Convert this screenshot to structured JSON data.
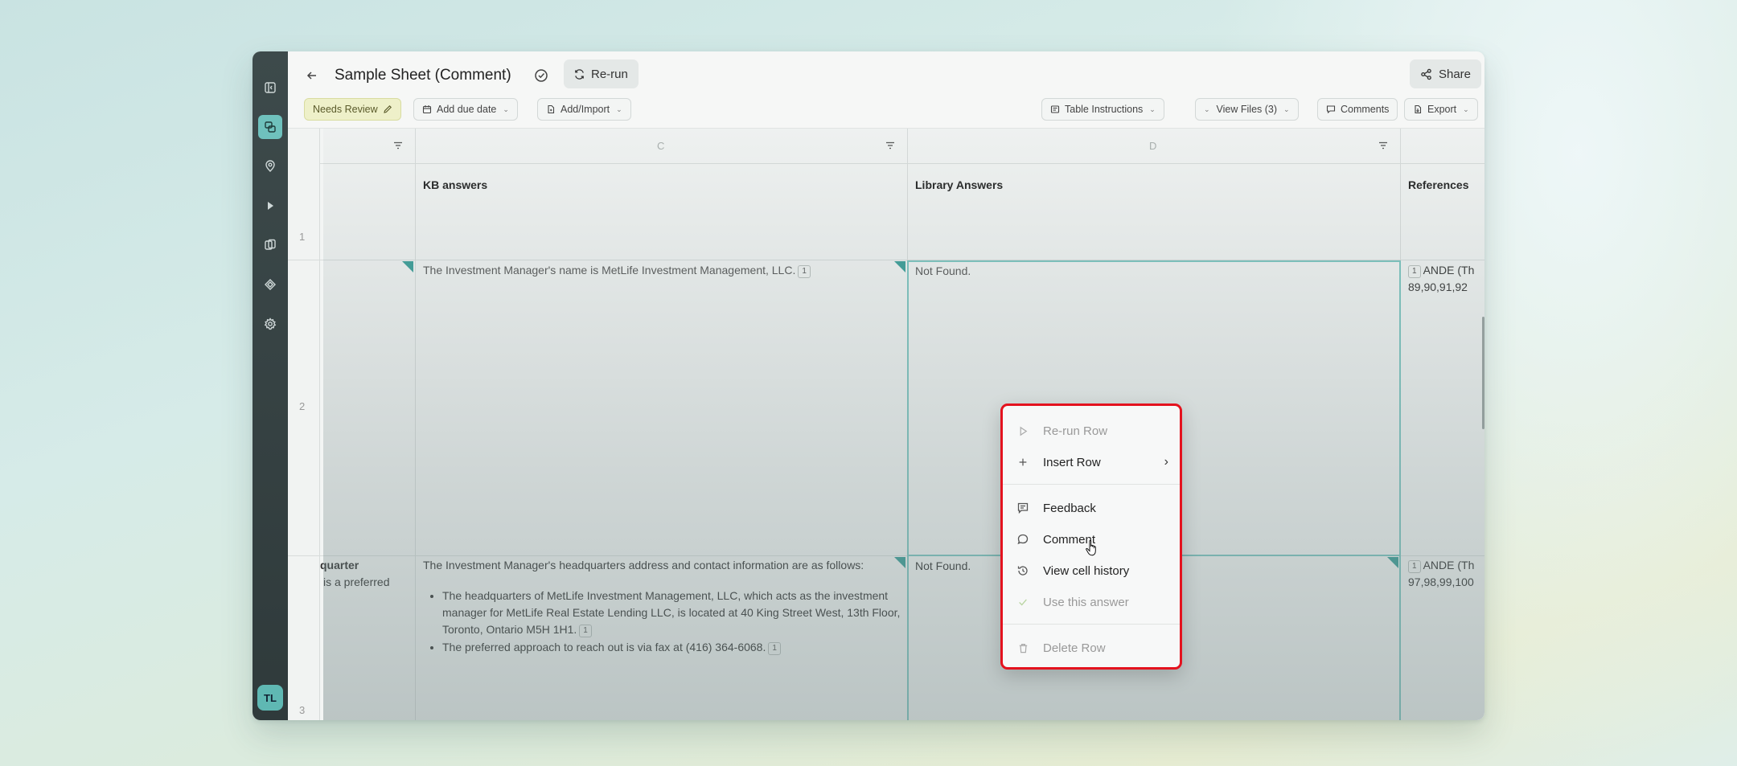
{
  "header": {
    "title": "Sample Sheet (Comment)",
    "rerun_label": "Re-run",
    "share_label": "Share"
  },
  "toolbar": {
    "needs_review": "Needs Review",
    "add_due_date": "Add due date",
    "add_import": "Add/Import",
    "table_instructions": "Table Instructions",
    "view_files": "View Files (3)",
    "comments": "Comments",
    "export": "Export"
  },
  "grid": {
    "columns": [
      {
        "letter": "C",
        "header": "KB answers"
      },
      {
        "letter": "D",
        "header": "Library Answers"
      },
      {
        "letter": "",
        "header": "References"
      }
    ],
    "rows": [
      {
        "num": "1"
      },
      {
        "num": "2",
        "kb_answer": "The Investment Manager's name is MetLife Investment Management, LLC.",
        "kb_ref": "1",
        "library_answer": "Not Found.",
        "ref_badge": "1",
        "ref_text": "ANDE (Th",
        "ref_pages": "89,90,91,92"
      },
      {
        "num": "3",
        "left_fragment_1": "quarter",
        "left_fragment_2": "is a preferred",
        "kb_answer": "The Investment Manager's headquarters address and contact information are as follows:",
        "bullets": [
          {
            "text": "The headquarters of MetLife Investment Management, LLC, which acts as the investment manager for MetLife Real Estate Lending LLC, is located at 40 King Street West, 13th Floor, Toronto, Ontario M5H 1H1.",
            "ref": "1"
          },
          {
            "text": "The preferred approach to reach out is via fax at (416) 364-6068.",
            "ref": "1"
          }
        ],
        "library_answer": "Not Found.",
        "ref_badge": "1",
        "ref_text": "ANDE (Th",
        "ref_pages": "97,98,99,100"
      }
    ]
  },
  "context_menu": {
    "items": [
      {
        "label": "Re-run Row",
        "icon": "play-icon",
        "disabled": true
      },
      {
        "label": "Insert Row",
        "icon": "plus-icon",
        "disabled": false
      },
      {
        "label": "Feedback",
        "icon": "feedback-icon",
        "disabled": false
      },
      {
        "label": "Comment",
        "icon": "comment-icon",
        "disabled": false
      },
      {
        "label": "View cell history",
        "icon": "history-icon",
        "disabled": false
      },
      {
        "label": "Use this answer",
        "icon": "check-icon",
        "disabled": true
      },
      {
        "label": "Delete Row",
        "icon": "trash-icon",
        "disabled": true
      }
    ]
  },
  "user": {
    "initials": "TL"
  },
  "colors": {
    "accent": "#6fc1bd",
    "highlight": "#e4121e"
  }
}
